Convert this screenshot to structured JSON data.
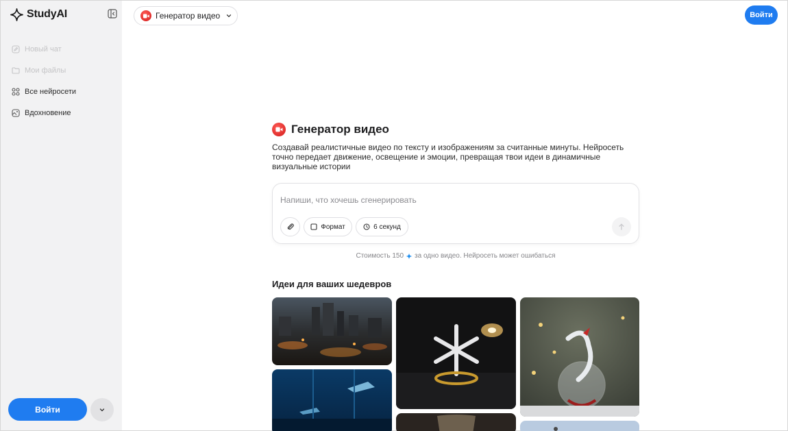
{
  "sidebar": {
    "logo_text": "StudyAI",
    "items": [
      {
        "label": "Новый чат",
        "icon": "edit-icon",
        "disabled": true
      },
      {
        "label": "Мои файлы",
        "icon": "folder-icon",
        "disabled": true
      },
      {
        "label": "Все нейросети",
        "icon": "grid-icon",
        "disabled": false
      },
      {
        "label": "Вдохновение",
        "icon": "image-icon",
        "disabled": false
      }
    ],
    "login_label": "Войти"
  },
  "header": {
    "model_label": "Генератор видео",
    "login_label": "Войти"
  },
  "main": {
    "title": "Генератор видео",
    "description": "Создавай реалистичные видео по тексту и изображениям за считанные минуты. Нейросеть точно передает движение, освещение и эмоции, превращая твои идеи в динамичные визуальные истории",
    "prompt": {
      "placeholder": "Напиши, что хочешь сгенерировать",
      "value": "",
      "format_label": "Формат",
      "duration_label": "6 секунд"
    },
    "cost_prefix": "Стоимость 150",
    "cost_suffix": "за одно видео. Нейросеть может ошибаться",
    "ideas_title": "Идеи для ваших шедевров"
  },
  "colors": {
    "accent": "#1f7cf0",
    "record": "#e0231f",
    "sidebar_bg": "#f2f2f3"
  }
}
